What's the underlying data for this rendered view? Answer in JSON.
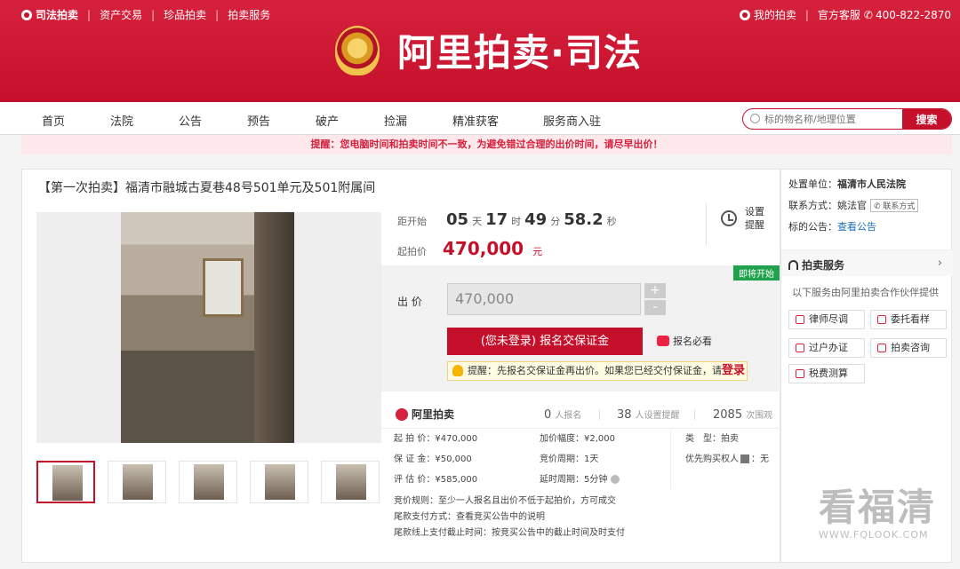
{
  "topbar": {
    "brand": "司法拍卖",
    "links": [
      "资产交易",
      "珍品拍卖",
      "拍卖服务"
    ],
    "my_auction": "我的拍卖",
    "service": "官方客服",
    "phone": "400-822-2870"
  },
  "logo": {
    "text": "阿里拍卖·司法"
  },
  "nav": {
    "items": [
      "首页",
      "法院",
      "公告",
      "预告",
      "破产",
      "捡漏",
      "精准获客",
      "服务商入驻"
    ],
    "search_placeholder": "标的物名称/地理位置",
    "search_button": "搜索"
  },
  "notice": "提醒：您电脑时间和拍卖时间不一致，为避免错过合理的出价时间，请尽早出价！",
  "lot": {
    "title": "【第一次拍卖】福清市融城古夏巷48号501单元及501附属间",
    "countdown_label": "距开始",
    "days": "05",
    "days_unit": "天",
    "hours": "17",
    "hours_unit": "时",
    "minutes": "49",
    "minutes_unit": "分",
    "seconds": "58.2",
    "seconds_unit": "秒",
    "remind": "设置提醒",
    "start_price_label": "起拍价",
    "start_price": "470,000",
    "start_price_unit": "元",
    "soon_badge": "即将开始",
    "bid_label": "出 价",
    "bid_value": "470,000",
    "plus": "+",
    "minus": "-",
    "deposit_button": "(您未登录) 报名交保证金",
    "must_read": "报名必看",
    "tip": "提醒：先报名交保证金再出价。如果您已经交付保证金，请",
    "tip_login": "登录"
  },
  "stats": {
    "brand": "阿里拍卖",
    "registered": "0",
    "registered_label": "人报名",
    "reminders": "38",
    "reminders_label": "人设置提醒",
    "views": "2085",
    "views_label": "次围观"
  },
  "details": {
    "start_price": "起 拍 价：¥470,000",
    "deposit": "保 证 金：¥50,000",
    "appraisal": "评 估 价：¥585,000",
    "increment": "加价幅度：¥2,000",
    "cycle": "竞价周期：1天",
    "extension": "延时周期：5分钟",
    "type": "类　型：拍卖",
    "priority": "优先购买权人",
    "priority_value": "：无",
    "rule": "竞价规则：至少一人报名且出价不低于起拍价，方可成交",
    "payment": "尾款支付方式：查看竞买公告中的说明",
    "deadline": "尾款线上支付截止时间：按竞买公告中的截止时间及时支付"
  },
  "side": {
    "court_label": "处置单位：",
    "court": "福清市人民法院",
    "contact_label": "联系方式：",
    "contact": "姚法官",
    "contact_tag": "联系方式",
    "notice_label": "标的公告：",
    "notice_link": "查看公告",
    "services_title": "拍卖服务",
    "services_desc": "以下服务由阿里拍卖合作伙伴提供",
    "services": [
      "律师尽调",
      "委托看样",
      "过户办证",
      "拍卖咨询",
      "税费测算"
    ]
  },
  "watermark": {
    "line1": "看福清",
    "line2": "WWW.FQLOOK.COM"
  }
}
